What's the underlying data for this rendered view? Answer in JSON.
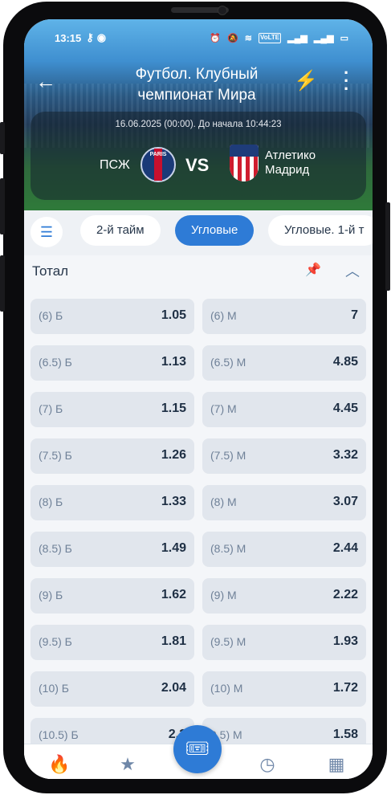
{
  "status": {
    "time": "13:15",
    "right_icons": [
      "alarm-icon",
      "mute-icon",
      "wifi-icon",
      "volte-icon",
      "signal-icon",
      "signal-icon",
      "battery-icon"
    ],
    "volte_text": "VoLTE"
  },
  "header": {
    "title": "Футбол. Клубный чемпионат Мира",
    "back_icon": "arrow-left-icon",
    "action_icon": "lightning-icon",
    "menu_icon": "kebab-menu-icon"
  },
  "match": {
    "datetime": "16.06.2025 (00:00). До начала 10:44:23",
    "home_team": "ПСЖ",
    "home_logo_text": "PARIS",
    "vs": "VS",
    "away_team": "Атлетико Мадрид"
  },
  "tabs": {
    "list_icon": "list-icon",
    "items": [
      {
        "label": "2-й тайм",
        "active": false
      },
      {
        "label": "Угловые",
        "active": true
      },
      {
        "label": "Угловые. 1-й т",
        "active": false
      }
    ]
  },
  "section": {
    "title": "Тотал",
    "pin_icon": "pin-icon",
    "collapse_icon": "chevron-up-icon"
  },
  "odds": [
    {
      "over_label": "(6) Б",
      "over": "1.05",
      "under_label": "(6) М",
      "under": "7"
    },
    {
      "over_label": "(6.5) Б",
      "over": "1.13",
      "under_label": "(6.5) М",
      "under": "4.85"
    },
    {
      "over_label": "(7) Б",
      "over": "1.15",
      "under_label": "(7) М",
      "under": "4.45"
    },
    {
      "over_label": "(7.5) Б",
      "over": "1.26",
      "under_label": "(7.5) М",
      "under": "3.32"
    },
    {
      "over_label": "(8) Б",
      "over": "1.33",
      "under_label": "(8) М",
      "under": "3.07"
    },
    {
      "over_label": "(8.5) Б",
      "over": "1.49",
      "under_label": "(8.5) М",
      "under": "2.44"
    },
    {
      "over_label": "(9) Б",
      "over": "1.62",
      "under_label": "(9) М",
      "under": "2.22"
    },
    {
      "over_label": "(9.5) Б",
      "over": "1.81",
      "under_label": "(9.5) М",
      "under": "1.93"
    },
    {
      "over_label": "(10) Б",
      "over": "2.04",
      "under_label": "(10) М",
      "under": "1.72"
    },
    {
      "over_label": "(10.5) Б",
      "over": "2.2",
      "under_label": "0.5) М",
      "under": "1.58"
    }
  ],
  "bottom_nav": {
    "items": [
      {
        "name": "fire-icon"
      },
      {
        "name": "star-icon"
      },
      {
        "name": "coupon-icon"
      },
      {
        "name": "clock-icon"
      },
      {
        "name": "apps-icon"
      }
    ]
  },
  "colors": {
    "accent": "#2e7bd6",
    "cell_bg": "#e1e6ed",
    "text_dark": "#1e2f44",
    "text_muted": "#6f8198"
  }
}
